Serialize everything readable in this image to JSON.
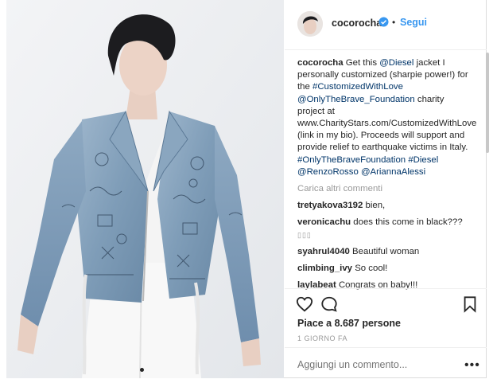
{
  "header": {
    "username": "cocorocha",
    "separator": "•",
    "follow_label": "Segui"
  },
  "caption": {
    "username": "cocorocha",
    "text_1": "Get this ",
    "mention_diesel": "@Diesel",
    "text_2": " jacket I personally customized (sharpie power!) for the ",
    "hashtag_customized": "#CustomizedWithLove",
    "text_3": " ",
    "mention_onlythebrave": "@OnlyTheBrave_Foundation",
    "text_4": " charity project at www.CharityStars.com/CustomizedWithLove (link in my bio). Proceeds will support and provide relief to earthquake victims in Italy. ",
    "hashtag_otbf": "#OnlyTheBraveFoundation",
    "text_5": " ",
    "hashtag_diesel": "#Diesel",
    "text_6": " ",
    "mention_renzo": "@RenzoRosso",
    "text_7": " ",
    "mention_arianna": "@AriannaAlessi"
  },
  "load_more_label": "Carica altri commenti",
  "comments": [
    {
      "user": "tretyakova3192",
      "text": "bien,"
    },
    {
      "user": "veronicachu",
      "text": "does this come in black???",
      "extra": "▯▯▯"
    },
    {
      "user": "syahrul4040",
      "text": "Beautiful woman"
    },
    {
      "user": "climbing_ivy",
      "text": "So cool!"
    },
    {
      "user": "laylabeat",
      "text": "Congrats on baby!!!"
    }
  ],
  "likes_text": "Piace a 8.687 persone",
  "date_text": "1 GIORNO FA",
  "add_comment_placeholder": "Aggiungi un commento...",
  "options_label": "•••",
  "icons": {
    "like": "heart-icon",
    "comment": "comment-bubble-icon",
    "save": "bookmark-icon",
    "verified": "verified-badge-icon"
  },
  "colors": {
    "link": "#003569",
    "follow": "#3897f0",
    "verified": "#3897f0",
    "muted": "#999999"
  }
}
